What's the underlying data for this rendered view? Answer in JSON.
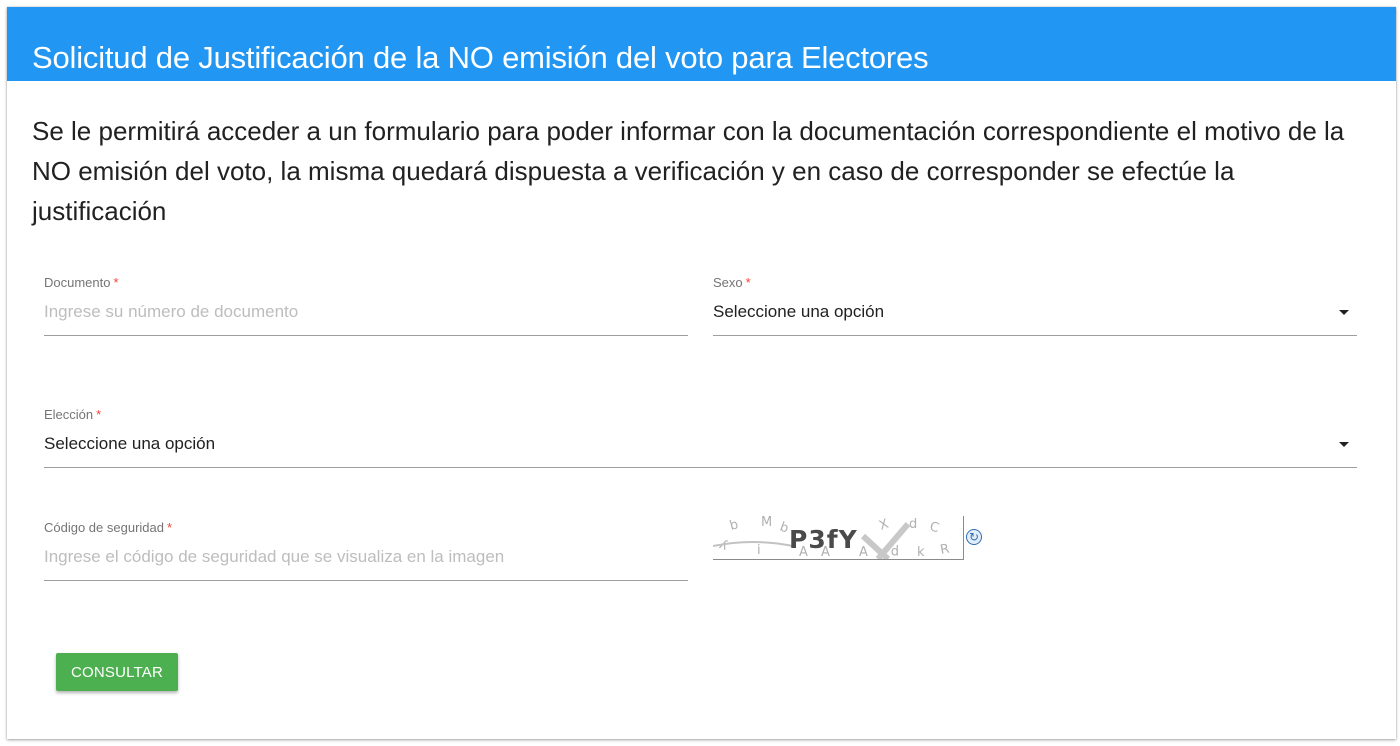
{
  "header": {
    "title": "Solicitud de Justificación de la NO emisión del voto para Electores",
    "color": "#2196f3"
  },
  "description": "Se le permitirá acceder a un formulario para poder informar con la documentación correspondiente el motivo de la NO emisión del voto, la misma quedará dispuesta a verificación y en caso de corresponder se efectúe la justificación",
  "form": {
    "required_mark": "*",
    "documento": {
      "label": "Documento",
      "value": "",
      "placeholder": "Ingrese su número de documento"
    },
    "sexo": {
      "label": "Sexo",
      "selected": "Seleccione una opción"
    },
    "eleccion": {
      "label": "Elección",
      "selected": "Seleccione una opción"
    },
    "codigo": {
      "label": "Código de seguridad",
      "value": "",
      "placeholder": "Ingrese el código de seguridad que se visualiza en la imagen"
    },
    "captcha": {
      "code": "P3fY",
      "noise": [
        "b",
        "M",
        "b",
        "y",
        "i",
        "A",
        "X",
        "d",
        "C",
        "p",
        "A",
        "R",
        "k",
        "A"
      ]
    },
    "refresh_icon": "refresh-icon"
  },
  "button": {
    "label": "CONSULTAR",
    "color": "#4caf50"
  }
}
